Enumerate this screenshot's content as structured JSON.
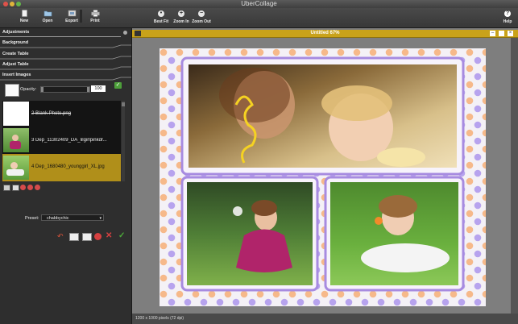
{
  "app_title": "UberCollage",
  "toolbar": {
    "new": "New",
    "open": "Open",
    "export": "Export",
    "print": "Print",
    "best_fit": "Best Fit",
    "zoom_in": "Zoom In",
    "zoom_out": "Zoom Out",
    "help": "Help"
  },
  "sidebar": {
    "adjustments": "Adjustments",
    "background": "Background",
    "create_table": "Create Table",
    "adjust_table": "Adjust Table",
    "insert_images": "Insert Images",
    "opacity_label": "Opacity:",
    "opacity_value": "100",
    "images": [
      {
        "label": "2 Blank Photo.png"
      },
      {
        "label": "3 Dep_11302409_DA_lilgirlpinkdr..."
      },
      {
        "label": "4 Dep_1680480_younggirl_XL.jpg"
      }
    ],
    "preset_label": "Preset:",
    "preset_value": "chabbychic"
  },
  "document": {
    "title": "Untitled 67%",
    "status": "1200 x 1000 pixels (72 dpi)"
  },
  "colors": {
    "accent": "#c9a21a",
    "selected_row": "#b08f1a",
    "frame": "#a78be0",
    "dot_orange": "#f6b98a",
    "dot_purple": "#b7a3ee"
  }
}
